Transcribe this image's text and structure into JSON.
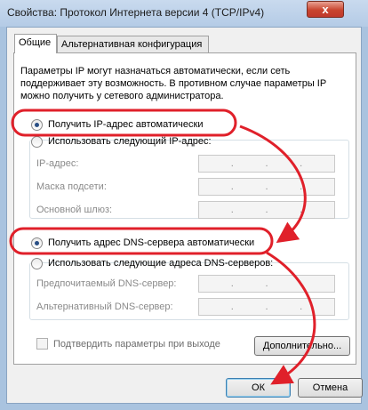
{
  "window": {
    "title": "Свойства: Протокол Интернета версии 4 (TCP/IPv4)",
    "close_glyph": "x"
  },
  "tabs": [
    {
      "label": "Общие",
      "active": true
    },
    {
      "label": "Альтернативная конфигурация",
      "active": false
    }
  ],
  "description": "Параметры IP могут назначаться автоматически, если сеть поддерживает эту возможность. В противном случае параметры IP можно получить у сетевого администратора.",
  "ip_section": {
    "auto_label": "Получить IP-адрес автоматически",
    "auto_selected": true,
    "manual_label": "Использовать следующий IP-адрес:",
    "fields": [
      {
        "label": "IP-адрес:"
      },
      {
        "label": "Маска подсети:"
      },
      {
        "label": "Основной шлюз:"
      }
    ]
  },
  "dns_section": {
    "auto_label": "Получить адрес DNS-сервера автоматически",
    "auto_selected": true,
    "manual_label": "Использовать следующие адреса DNS-серверов:",
    "fields": [
      {
        "label": "Предпочитаемый DNS-сервер:"
      },
      {
        "label": "Альтернативный DNS-сервер:"
      }
    ]
  },
  "validate_checkbox": {
    "label": "Подтвердить параметры при выходе",
    "checked": false
  },
  "buttons": {
    "advanced": "Дополнительно...",
    "ok": "ОК",
    "cancel": "Отмена"
  },
  "annotation_color": "#e0202a",
  "ip_dot": "."
}
